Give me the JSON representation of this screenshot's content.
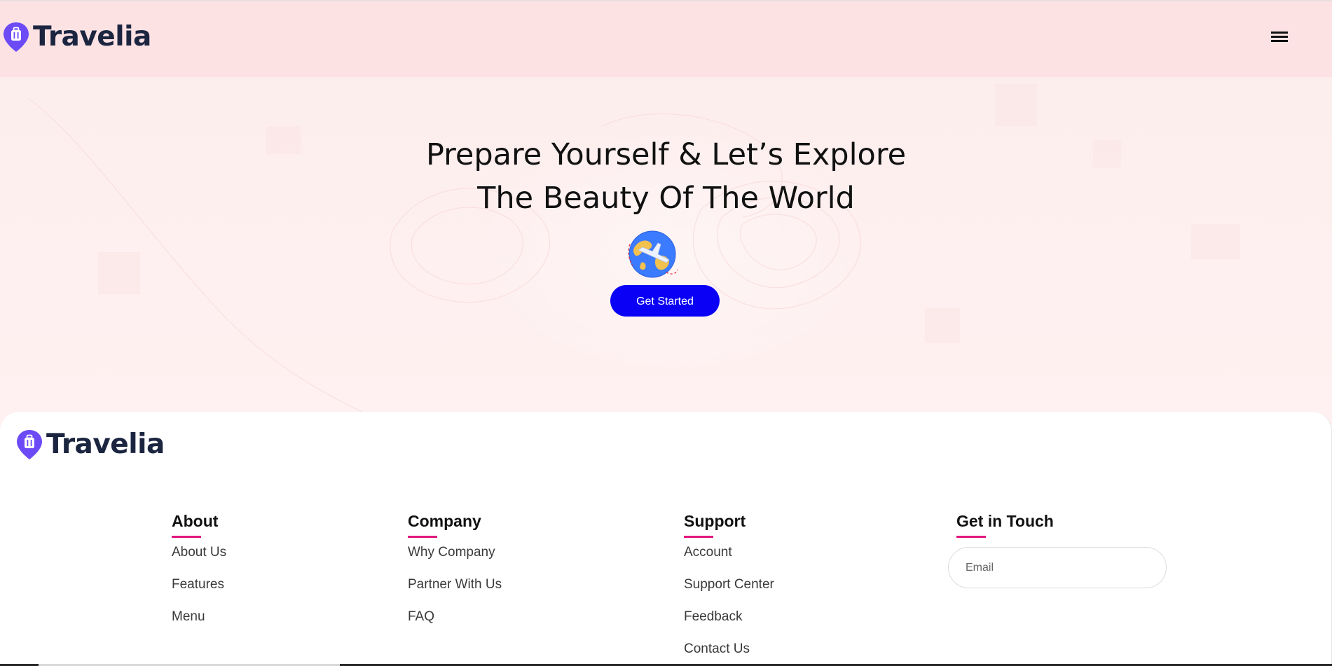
{
  "header": {
    "brand": "Travelia",
    "menu_icon": "hamburger-menu-icon"
  },
  "hero": {
    "title_line1": "Prepare Yourself & Let’s Explore",
    "title_line2": "The Beauty Of The World",
    "illustration": "globe-airplane-icon",
    "cta_label": "Get Started",
    "cta_color": "#0a00f5"
  },
  "footer": {
    "brand": "Travelia",
    "accent_color": "#e0177f",
    "columns": [
      {
        "heading": "About",
        "links": [
          "About Us",
          "Features",
          "Menu"
        ]
      },
      {
        "heading": "Company",
        "links": [
          "Why Company",
          "Partner With Us",
          "FAQ"
        ]
      },
      {
        "heading": "Support",
        "links": [
          "Account",
          "Support Center",
          "Feedback",
          "Contact Us"
        ]
      },
      {
        "heading": "Get in Touch",
        "links": []
      }
    ],
    "email_placeholder": "Email"
  },
  "colors": {
    "brand_purple": "#6c4bf6",
    "brand_text": "#1c2540",
    "hero_bg": "#fdeeee"
  }
}
